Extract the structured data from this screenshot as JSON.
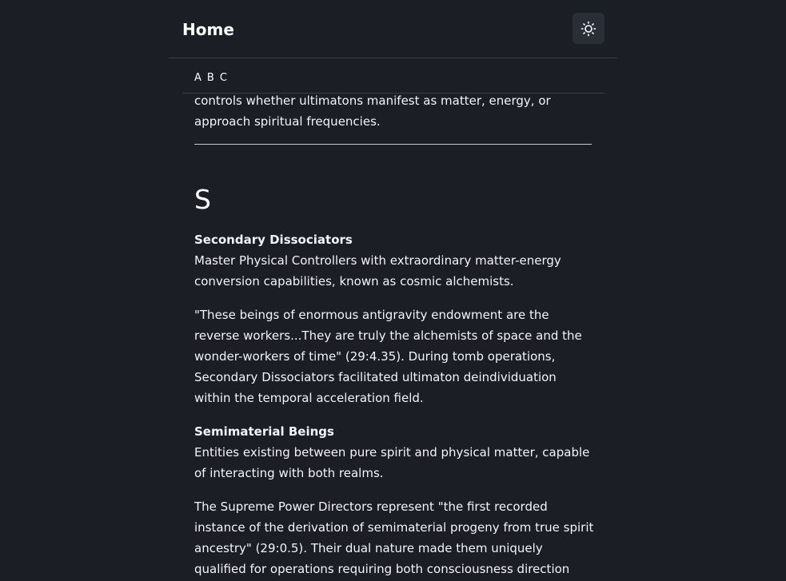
{
  "header": {
    "title": "Home",
    "theme_toggle_icon": "sun-icon"
  },
  "alpha_nav": {
    "letters": [
      "A",
      "B",
      "C"
    ]
  },
  "content": {
    "intro_text": "controls whether ultimatons manifest as matter, energy, or approach spiritual frequencies.",
    "section_letter": "S",
    "entries": [
      {
        "term": "Secondary Dissociators",
        "definition": "Master Physical Controllers with extraordinary matter-energy conversion capabilities, known as cosmic alchemists.",
        "note": "\"These beings of enormous antigravity endowment are the reverse workers...They are truly the alchemists of space and the wonder-workers of time\" (29:4.35). During tomb operations, Secondary Dissociators facilitated ultimaton deindividuation within the temporal acceleration field."
      },
      {
        "term": "Semimaterial Beings",
        "definition": "Entities existing between pure spirit and physical matter, capable of interacting with both realms.",
        "note": "The Supreme Power Directors represent \"the first recorded instance of the derivation of semimaterial progeny from true spirit ancestry\" (29:0.5). Their dual nature made them uniquely qualified for operations requiring both consciousness direction and physical"
      }
    ]
  }
}
